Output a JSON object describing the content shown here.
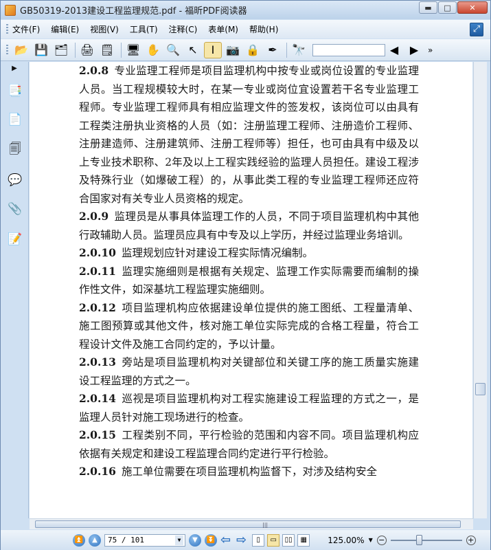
{
  "window": {
    "title": "GB50319-2013建设工程监理规范.pdf - 福昕PDF阅读器",
    "min_label": "▬",
    "max_label": "□",
    "close_label": "✕"
  },
  "menu": {
    "items": [
      "文件(F)",
      "编辑(E)",
      "视图(V)",
      "工具(T)",
      "注释(C)",
      "表单(M)",
      "帮助(H)"
    ]
  },
  "toolbar": {
    "search_value": "",
    "more_label": "»"
  },
  "document": {
    "paragraphs": [
      {
        "num": "2.0.8",
        "text": "专业监理工程师是项目监理机构中按专业或岗位设置的专业监理人员。当工程规模较大时，在某一专业或岗位宜设置若干名专业监理工程师。专业监理工程师具有相应监理文件的签发权，该岗位可以由具有工程类注册执业资格的人员（如：注册监理工程师、注册造价工程师、注册建造师、注册建筑师、注册工程师等）担任，也可由具有中级及以上专业技术职称、2年及以上工程实践经验的监理人员担任。建设工程涉及特殊行业（如爆破工程）的，从事此类工程的专业监理工程师还应符合国家对有关专业人员资格的规定。"
      },
      {
        "num": "2.0.9",
        "text": "监理员是从事具体监理工作的人员，不同于项目监理机构中其他行政辅助人员。监理员应具有中专及以上学历，并经过监理业务培训。"
      },
      {
        "num": "2.0.10",
        "text": "监理规划应针对建设工程实际情况编制。"
      },
      {
        "num": "2.0.11",
        "text": "监理实施细则是根据有关规定、监理工作实际需要而编制的操作性文件，如深基坑工程监理实施细则。"
      },
      {
        "num": "2.0.12",
        "text": "项目监理机构应依据建设单位提供的施工图纸、工程量清单、施工图预算或其他文件，核对施工单位实际完成的合格工程量，符合工程设计文件及施工合同约定的，予以计量。"
      },
      {
        "num": "2.0.13",
        "text": "旁站是项目监理机构对关键部位和关键工序的施工质量实施建设工程监理的方式之一。"
      },
      {
        "num": "2.0.14",
        "text": "巡视是项目监理机构对工程实施建设工程监理的方式之一，是监理人员针对施工现场进行的检查。"
      },
      {
        "num": "2.0.15",
        "text": "工程类别不同，平行检验的范围和内容不同。项目监理机构应依据有关规定和建设工程监理合同约定进行平行检验。"
      },
      {
        "num": "2.0.16",
        "text": "施工单位需要在项目监理机构监督下，对涉及结构安全"
      }
    ]
  },
  "statusbar": {
    "page_value": "75 / 101",
    "zoom_value": "125.00%",
    "zoom_level_percent": 40
  },
  "colors": {
    "accent": "#2f72c0",
    "active_tool_bg": "#f6e6a8",
    "window_bg": "#cfe0f2"
  }
}
